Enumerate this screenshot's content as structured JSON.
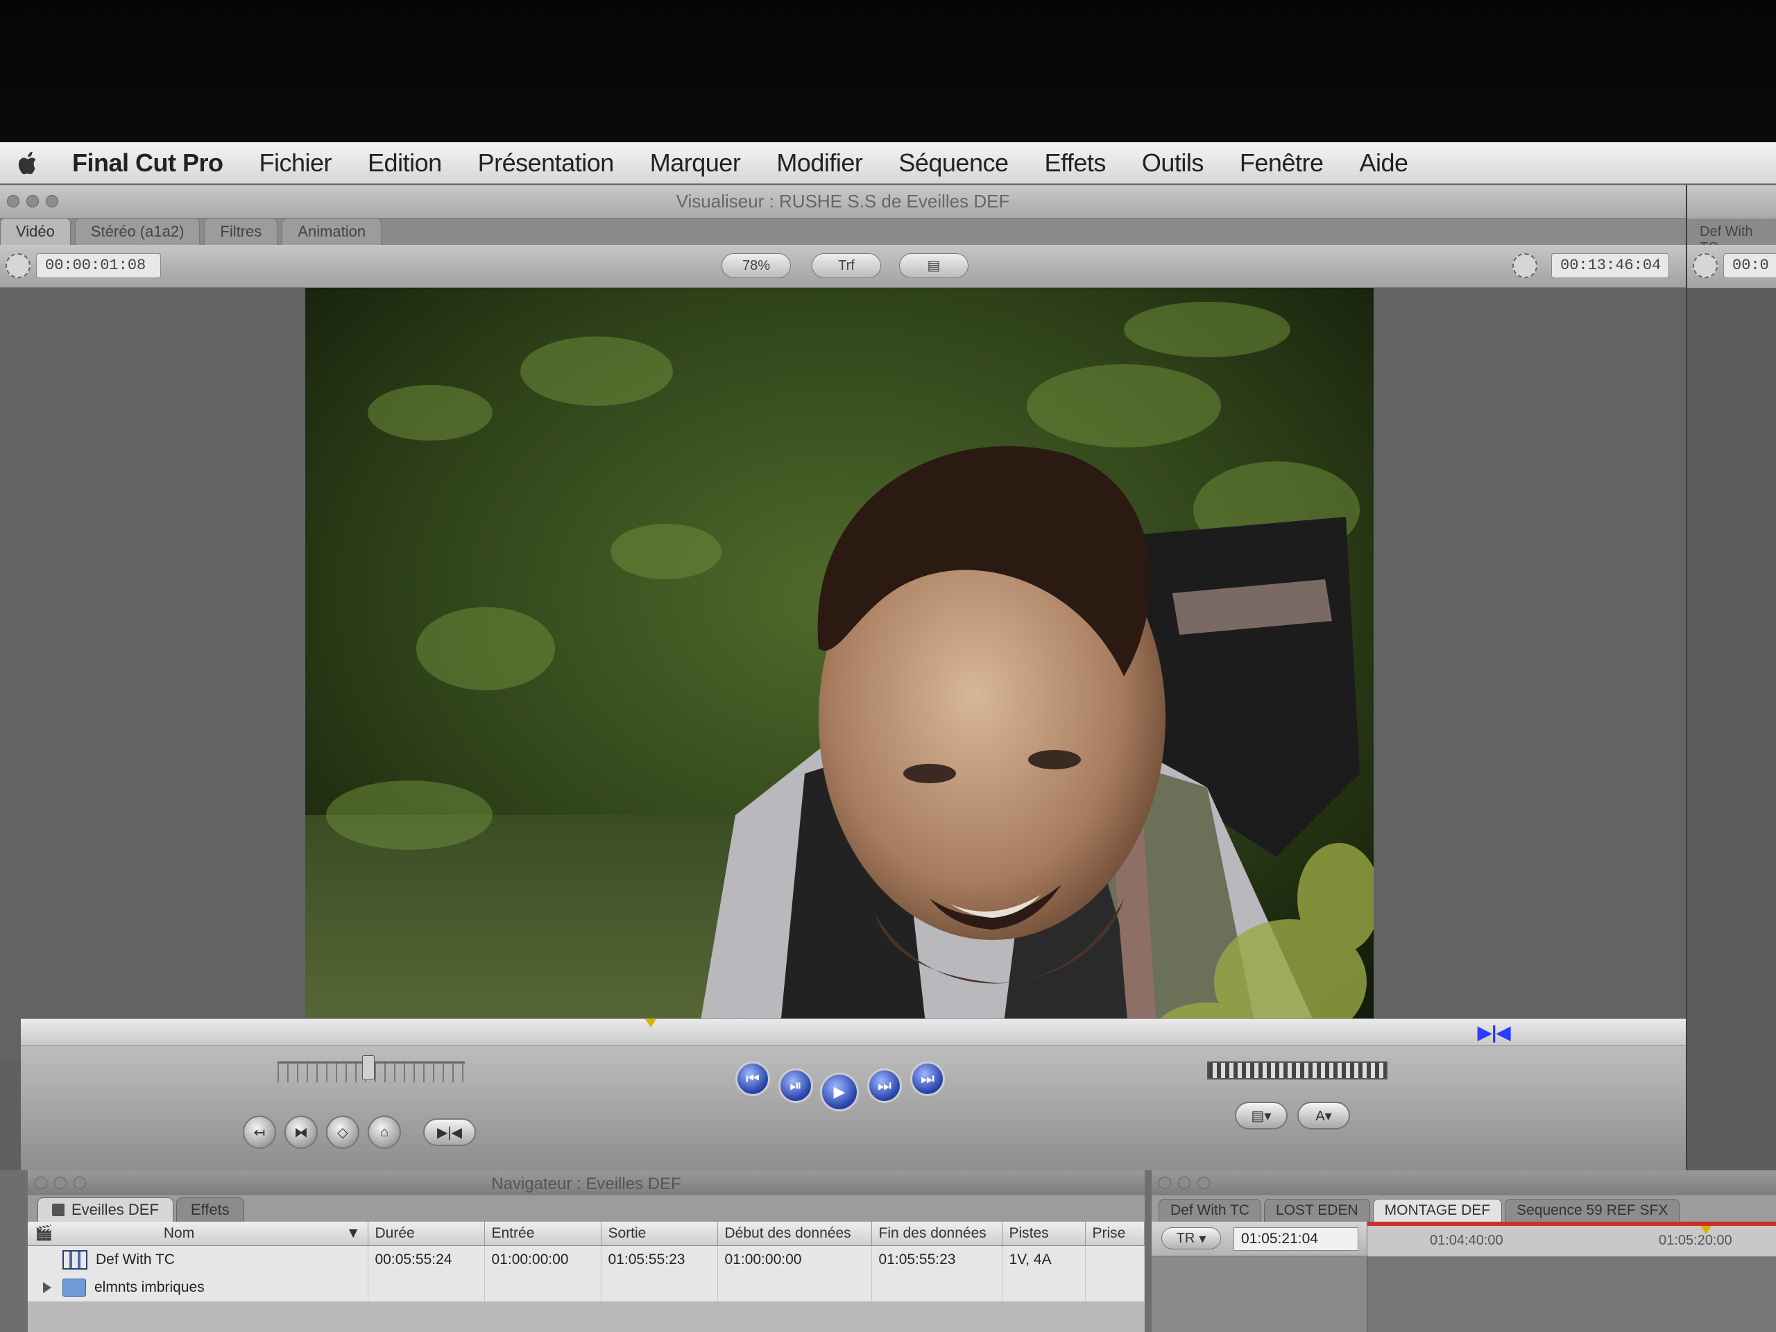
{
  "menubar": {
    "app_name": "Final Cut Pro",
    "items": [
      "Fichier",
      "Edition",
      "Présentation",
      "Marquer",
      "Modifier",
      "Séquence",
      "Effets",
      "Outils",
      "Fenêtre",
      "Aide"
    ]
  },
  "viewer": {
    "title": "Visualiseur : RUSHE S.S de Eveilles DEF",
    "tabs": [
      "Vidéo",
      "Stéréo (a1a2)",
      "Filtres",
      "Animation"
    ],
    "timecode_duration": "00:00:01:08",
    "timecode_current": "00:13:46:04",
    "zoom_label": "78%",
    "view_label": "Trf",
    "overlay_label": "▤"
  },
  "canvas_panel": {
    "tab": "Def With TC",
    "timecode": "00:0"
  },
  "browser": {
    "title": "Navigateur : Eveilles DEF",
    "tabs": [
      "Eveilles DEF",
      "Effets"
    ],
    "columns": [
      "Nom",
      "Durée",
      "Entrée",
      "Sortie",
      "Début des données",
      "Fin des données",
      "Pistes",
      "Prise"
    ],
    "rows": [
      {
        "name": "Def With TC",
        "duree": "00:05:55:24",
        "entree": "01:00:00:00",
        "sortie": "01:05:55:23",
        "debut": "01:00:00:00",
        "fin": "01:05:55:23",
        "pistes": "1V, 4A",
        "prise": ""
      },
      {
        "name": "elmnts imbriques",
        "duree": "",
        "entree": "",
        "sortie": "",
        "debut": "",
        "fin": "",
        "pistes": "",
        "prise": ""
      }
    ]
  },
  "timeline": {
    "tabs": [
      "Def With TC",
      "LOST EDEN",
      "MONTAGE DEF",
      "Sequence 59 REF SFX"
    ],
    "track_label": "TR",
    "timecode": "01:05:21:04",
    "ruler_labels": [
      "01:04:40:00",
      "01:05:20:00"
    ]
  },
  "colors": {
    "menubar": "#e6e6e6",
    "transport_blue": "#243fa8",
    "playhead_yellow": "#d8b400",
    "ruler_red": "#c9302c"
  }
}
